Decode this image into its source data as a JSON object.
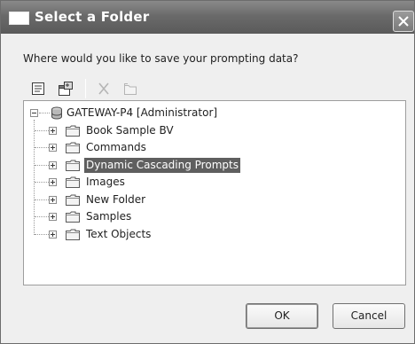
{
  "dialog": {
    "title": "Select a Folder",
    "prompt": "Where would you like to save your prompting data?"
  },
  "toolbar": {
    "items": [
      {
        "icon": "new-folder-icon",
        "enabled": true
      },
      {
        "icon": "properties-icon",
        "enabled": true
      },
      {
        "icon": "delete-icon",
        "enabled": false
      },
      {
        "icon": "folder-up-icon",
        "enabled": false
      }
    ]
  },
  "tree": {
    "root": {
      "label": "GATEWAY-P4 [Administrator]",
      "expanded": true
    },
    "children": [
      {
        "label": "Book Sample BV",
        "selected": false
      },
      {
        "label": "Commands",
        "selected": false
      },
      {
        "label": "Dynamic Cascading Prompts",
        "selected": true
      },
      {
        "label": "Images",
        "selected": false
      },
      {
        "label": "New Folder",
        "selected": false
      },
      {
        "label": "Samples",
        "selected": false
      },
      {
        "label": "Text Objects",
        "selected": false
      }
    ]
  },
  "buttons": {
    "ok": "OK",
    "cancel": "Cancel"
  },
  "colors": {
    "titlebar": "#6a6a6a",
    "selection": "#5f5f5f",
    "dialog_bg": "#efefef"
  }
}
